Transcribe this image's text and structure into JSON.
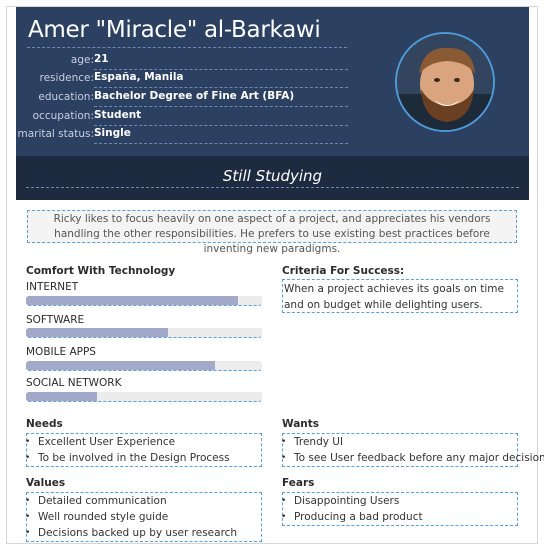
{
  "profile": {
    "name": "Amer \"Miracle\" al-Barkawi",
    "fields": [
      {
        "label": "age:",
        "value": "21"
      },
      {
        "label": "residence:",
        "value": "España, Manila"
      },
      {
        "label": "education:",
        "value": "Bachelor Degree of Fine Art (BFA)"
      },
      {
        "label": "occupation:",
        "value": "Student"
      },
      {
        "label": "marital status:",
        "value": "Single"
      }
    ],
    "status": "Still Studying"
  },
  "bio": "Ricky likes to focus heavily on one aspect of a project, and appreciates his vendors handling the other responsibilities. He prefers to use existing best practices before inventing new paradigms.",
  "comfort": {
    "title": "Comfort With Technology",
    "skills": [
      {
        "label": "INTERNET",
        "level": 0.9
      },
      {
        "label": "SOFTWARE",
        "level": 0.6
      },
      {
        "label": "MOBILE APPS",
        "level": 0.8
      },
      {
        "label": "SOCIAL NETWORK",
        "level": 0.3
      }
    ]
  },
  "criteria": {
    "title": "Criteria For Success:",
    "text": "When a project achieves its goals on time and on budget while delighting users."
  },
  "needs": {
    "title": "Needs",
    "items": [
      "Excellent User Experience",
      "To be involved in the Design Process"
    ]
  },
  "wants": {
    "title": "Wants",
    "items": [
      "Trendy UI",
      "To see User feedback before any major decision"
    ]
  },
  "values": {
    "title": "Values",
    "items": [
      "Detailed communication",
      "Well rounded style guide",
      "Decisions backed up by user research"
    ]
  },
  "fears": {
    "title": "Fears",
    "items": [
      "Disappointing Users",
      "Producing a bad product"
    ]
  },
  "colors": {
    "header_bg": "#2c4062",
    "status_bg": "#1d2a40",
    "skill_fill": "#a3a9c9",
    "dashed_accent": "#5aa0d8"
  }
}
